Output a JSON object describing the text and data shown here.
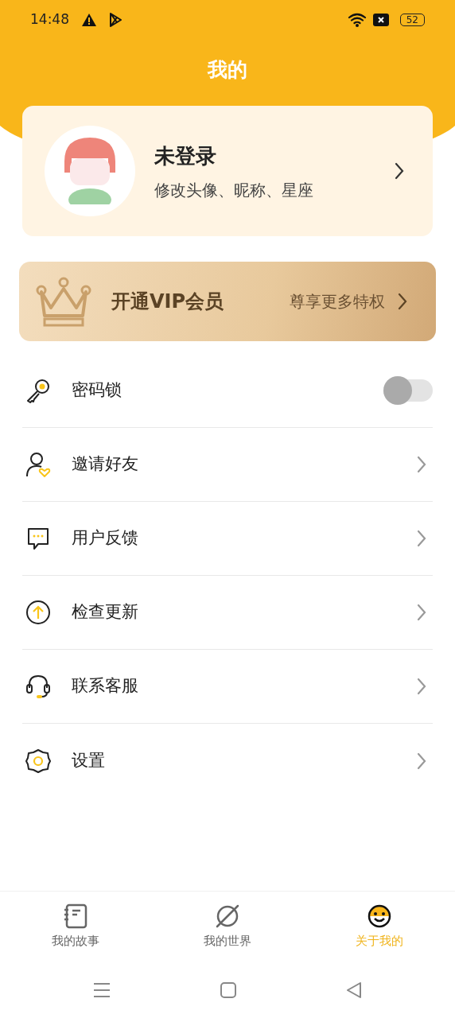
{
  "status_bar": {
    "time": "14:48",
    "battery": "52"
  },
  "title": "我的",
  "profile": {
    "name": "未登录",
    "subtitle": "修改头像、昵称、星座"
  },
  "vip": {
    "title": "开通VIP会员",
    "action": "尊享更多特权"
  },
  "menu": [
    {
      "kind": "toggle",
      "label": "密码锁",
      "on": false
    },
    {
      "kind": "link",
      "label": "邀请好友"
    },
    {
      "kind": "link",
      "label": "用户反馈"
    },
    {
      "kind": "link",
      "label": "检查更新"
    },
    {
      "kind": "link",
      "label": "联系客服"
    },
    {
      "kind": "link",
      "label": "设置"
    }
  ],
  "tabs": [
    {
      "label": "我的故事",
      "selected": false
    },
    {
      "label": "我的世界",
      "selected": false
    },
    {
      "label": "关于我的",
      "selected": true
    }
  ]
}
